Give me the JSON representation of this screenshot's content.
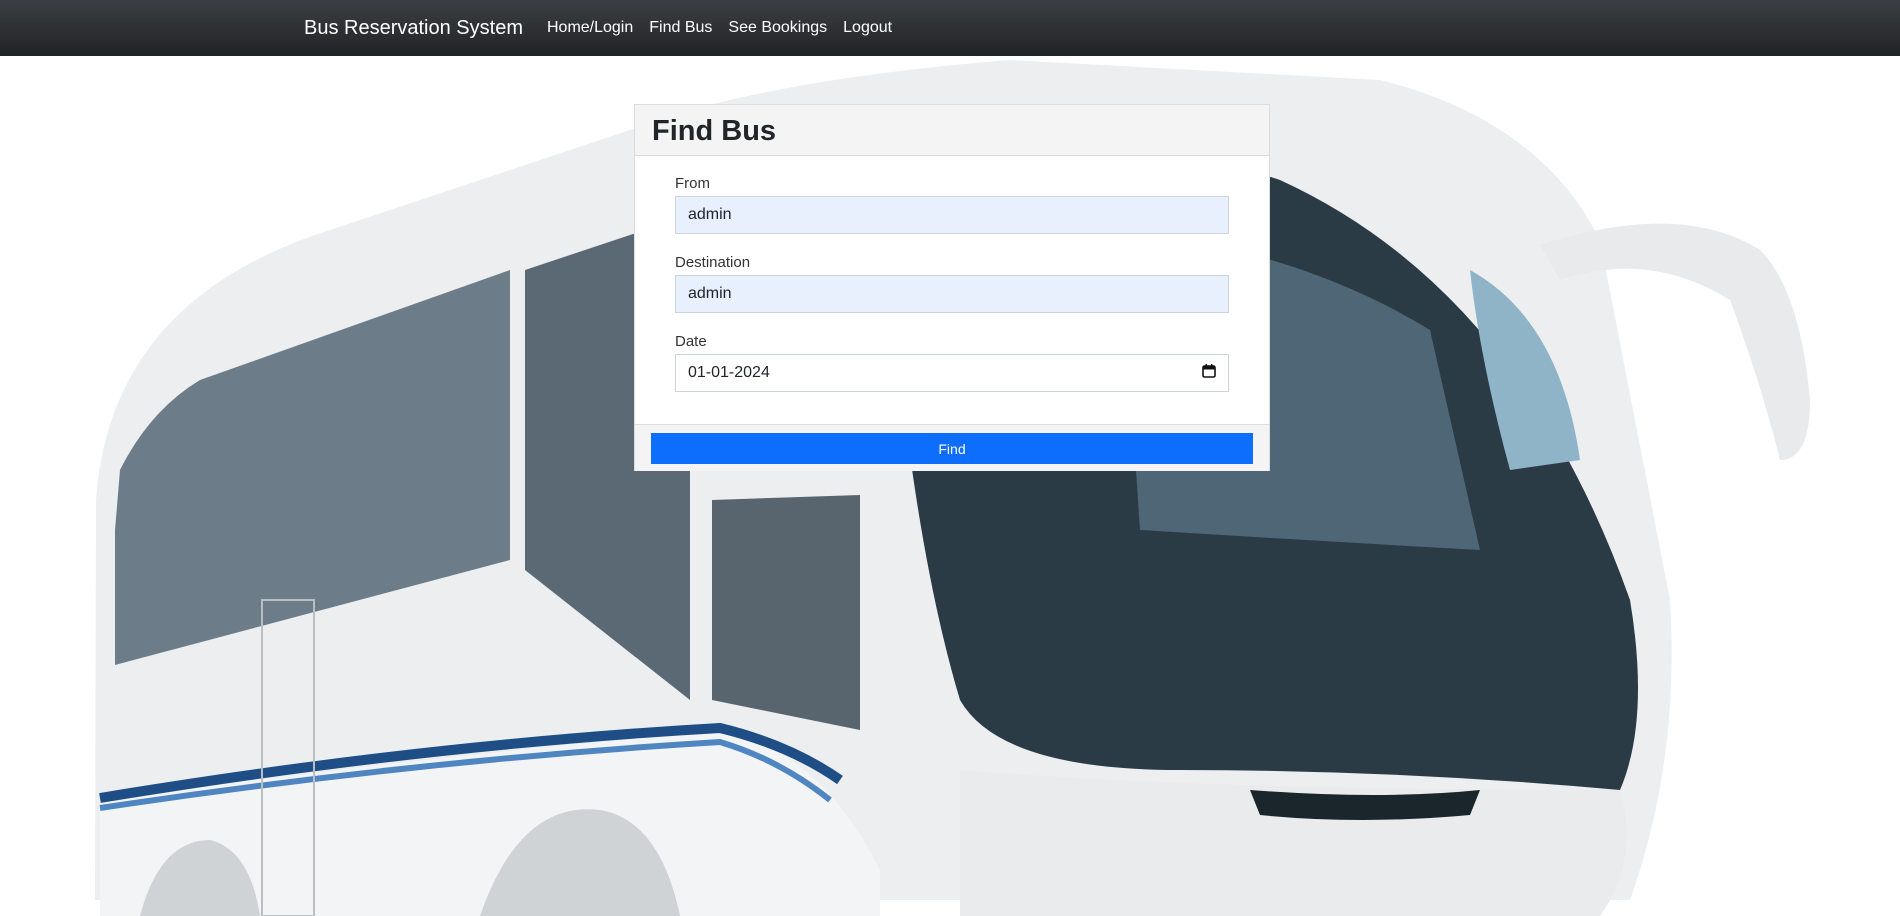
{
  "navbar": {
    "brand": "Bus Reservation System",
    "links": [
      "Home/Login",
      "Find Bus",
      "See Bookings",
      "Logout"
    ]
  },
  "form": {
    "title": "Find Bus",
    "from_label": "From",
    "from_value": "admin",
    "destination_label": "Destination",
    "destination_value": "admin",
    "date_label": "Date",
    "date_value": "01-01-2024",
    "date_icon": "calendar-icon",
    "submit_label": "Find"
  },
  "colors": {
    "navbar": "#212427",
    "primary": "#0d6efd",
    "autofill": "#e8f0fe"
  },
  "background_image": "bus-photo"
}
